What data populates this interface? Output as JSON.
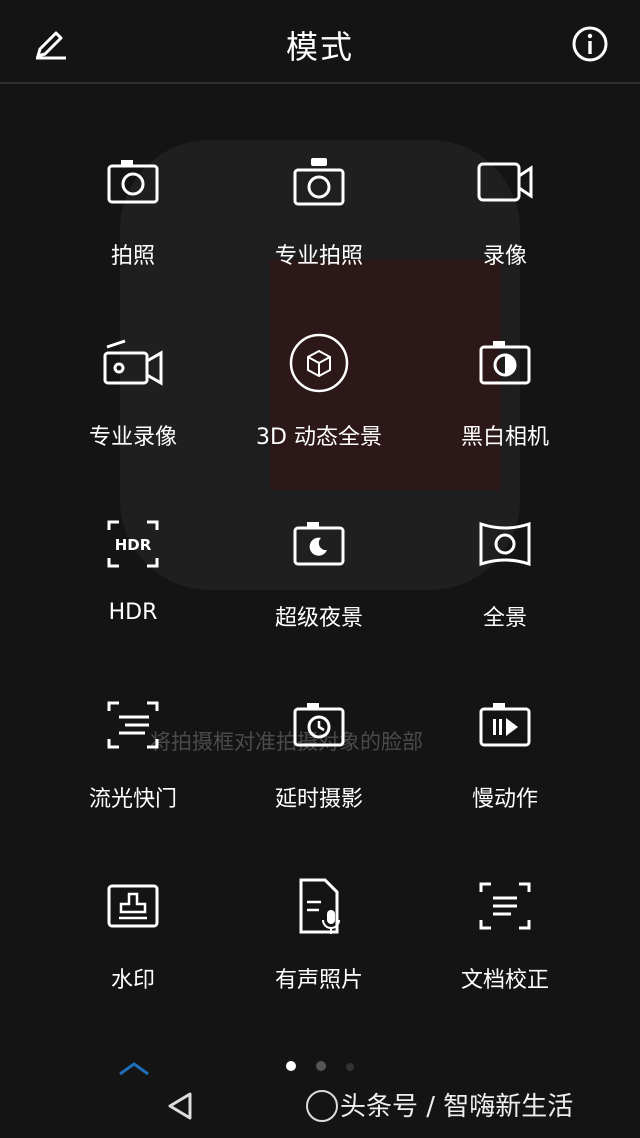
{
  "header": {
    "title": "模式"
  },
  "modes": [
    {
      "label": "拍照",
      "icon": "camera-icon"
    },
    {
      "label": "专业拍照",
      "icon": "pro-camera-icon"
    },
    {
      "label": "录像",
      "icon": "video-icon"
    },
    {
      "label": "专业录像",
      "icon": "pro-video-icon"
    },
    {
      "label": "3D 动态全景",
      "icon": "3d-panorama-icon"
    },
    {
      "label": "黑白相机",
      "icon": "monochrome-icon"
    },
    {
      "label": "HDR",
      "icon": "hdr-icon"
    },
    {
      "label": "超级夜景",
      "icon": "night-mode-icon"
    },
    {
      "label": "全景",
      "icon": "panorama-icon"
    },
    {
      "label": "流光快门",
      "icon": "light-painting-icon"
    },
    {
      "label": "延时摄影",
      "icon": "time-lapse-icon"
    },
    {
      "label": "慢动作",
      "icon": "slow-motion-icon"
    },
    {
      "label": "水印",
      "icon": "watermark-icon"
    },
    {
      "label": "有声照片",
      "icon": "audio-photo-icon"
    },
    {
      "label": "文档校正",
      "icon": "document-correction-icon"
    }
  ],
  "overlay_hint": "将拍摄框对准拍摄对象的脸部",
  "pager": {
    "pages": 3,
    "active_index": 0
  },
  "watermark": "头条号 / 智嗨新生活"
}
